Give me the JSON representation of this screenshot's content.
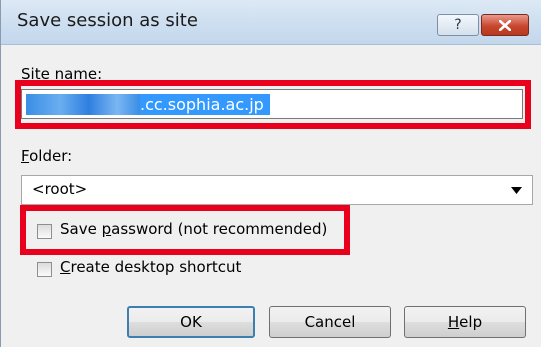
{
  "dialog": {
    "title": "Save session as site",
    "help_button": "?",
    "site_name_label": "Site name:",
    "site_name_value": ".cc.sophia.ac.jp",
    "folder_label": "Folder:",
    "folder_value": "<root>",
    "save_password_label": "Save password (not recommended)",
    "save_password_checked": false,
    "desktop_shortcut_label": "Create desktop shortcut",
    "desktop_shortcut_checked": false,
    "ok_label": "OK",
    "cancel_label": "Cancel",
    "help_label": "Help"
  },
  "colors": {
    "annotation": "#e8001c",
    "selection": "#3399ff",
    "default_button_border": "#3c7fb1",
    "close_button": "#c8472e"
  }
}
